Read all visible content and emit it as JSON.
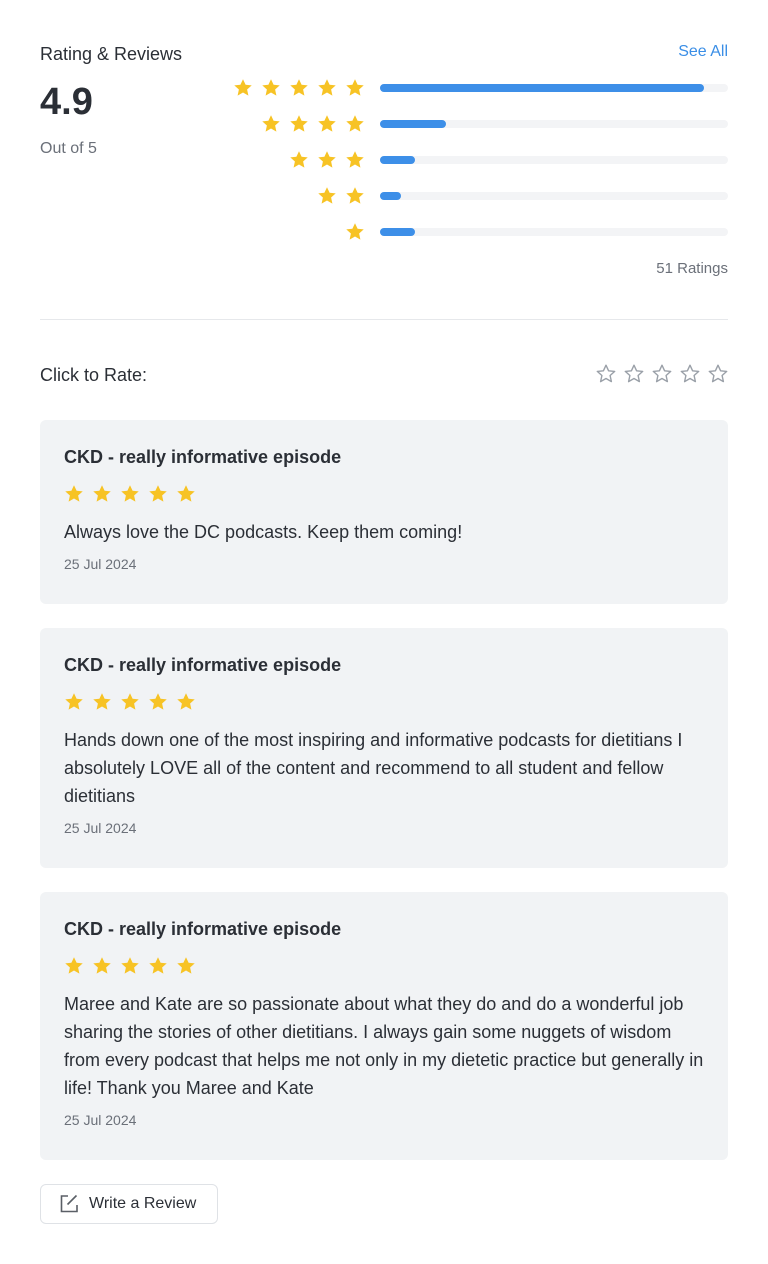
{
  "header": {
    "title": "Rating & Reviews",
    "see_all": "See All"
  },
  "summary": {
    "average": "4.9",
    "out_of": "Out of 5",
    "ratings_count": "51 Ratings",
    "distribution": [
      {
        "stars": 5,
        "fraction": 0.93
      },
      {
        "stars": 4,
        "fraction": 0.19
      },
      {
        "stars": 3,
        "fraction": 0.1
      },
      {
        "stars": 2,
        "fraction": 0.06
      },
      {
        "stars": 1,
        "fraction": 0.1
      }
    ]
  },
  "rate": {
    "label": "Click to Rate:",
    "current": 0,
    "max": 5
  },
  "reviews": [
    {
      "title": "CKD - really informative episode",
      "rating": 5,
      "text": "Always love the DC podcasts. Keep them coming!",
      "date": "25 Jul 2024"
    },
    {
      "title": "CKD - really informative episode",
      "rating": 5,
      "text": "Hands down one of the most inspiring and informative podcasts for dietitians I absolutely LOVE all of the content and recommend to all student and fellow dietitians",
      "date": "25 Jul 2024"
    },
    {
      "title": "CKD - really informative episode",
      "rating": 5,
      "text": "Maree and Kate are so passionate about what they do and do a wonderful job sharing the stories of other dietitians. I always gain some nuggets of wisdom from every podcast that helps me not only in my dietetic practice but generally in life! Thank you Maree and Kate",
      "date": "25 Jul 2024"
    }
  ],
  "write_review": {
    "label": "Write a Review",
    "icon": "edit-icon"
  },
  "colors": {
    "accent": "#3d8fe8",
    "star": "#f7c325",
    "card_bg": "#f1f3f5"
  }
}
